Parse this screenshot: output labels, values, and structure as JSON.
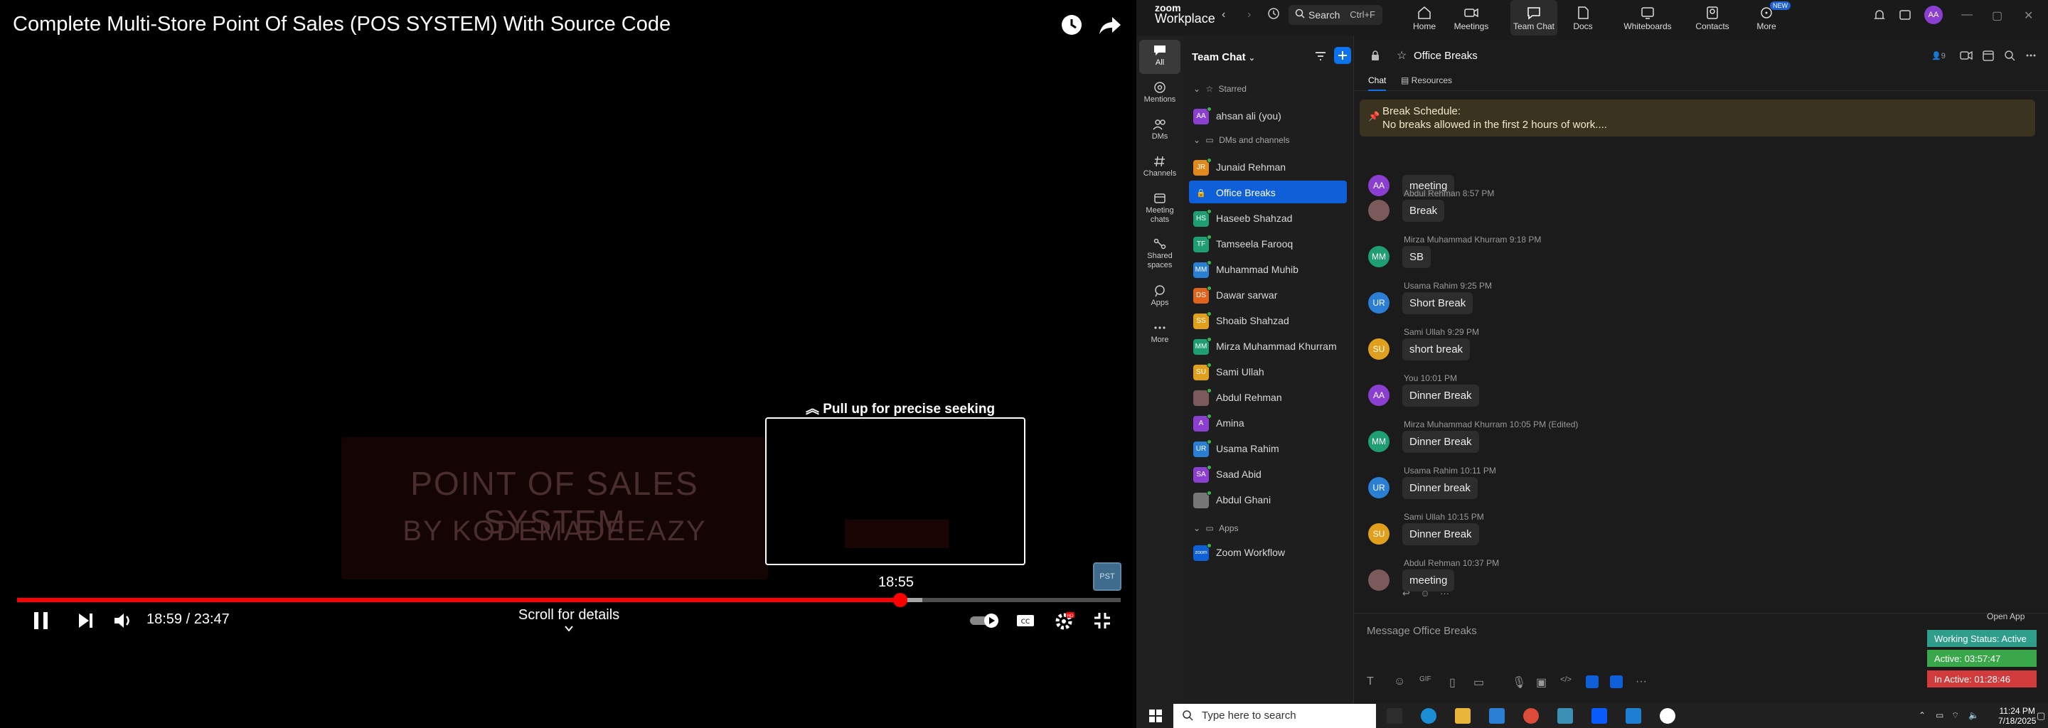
{
  "video": {
    "title": "Complete Multi-Store Point Of Sales (POS SYSTEM) With Source Code",
    "slide_line1": "POINT OF SALES SYSTEM",
    "slide_line2": "BY KODEMADEEAZY",
    "seek_hint": "Pull up for precise seeking",
    "preview_time": "18:55",
    "time_display": "18:59 / 23:47",
    "progress": 0.8,
    "buffered": 0.82,
    "scroll_hint": "Scroll for details",
    "channel_badge": "PST"
  },
  "zoom": {
    "logo_line1": "zoom",
    "logo_line2": "Workplace",
    "search_label": "Search",
    "search_shortcut": "Ctrl+F",
    "nav": [
      {
        "label": "Home"
      },
      {
        "label": "Meetings"
      },
      {
        "label": "Team Chat"
      },
      {
        "label": "Docs"
      },
      {
        "label": "Whiteboards"
      },
      {
        "label": "Contacts"
      },
      {
        "label": "More"
      }
    ],
    "new_badge": "NEW",
    "user_initials": "AA",
    "rail": [
      "All",
      "Mentions",
      "DMs",
      "Channels",
      "Meeting chats",
      "Shared spaces",
      "Apps",
      "More"
    ],
    "sidebar": {
      "title": "Team Chat",
      "starred_label": "Starred",
      "starred": [
        {
          "name": "ahsan ali (you)",
          "initials": "AA",
          "color": "#8b3fd1"
        }
      ],
      "dms_label": "DMs and channels",
      "dms": [
        {
          "name": "Junaid Rehman",
          "initials": "JR",
          "color": "#e08a1e"
        },
        {
          "name": "Office Breaks",
          "initials": "",
          "color": "#0e5fd8"
        },
        {
          "name": "Haseeb Shahzad",
          "initials": "HS",
          "color": "#1f9e74"
        },
        {
          "name": "Tamseela Farooq",
          "initials": "TF",
          "color": "#1f9e74"
        },
        {
          "name": "Muhammad Muhib",
          "initials": "MM",
          "color": "#2a7fd4"
        },
        {
          "name": "Dawar sarwar",
          "initials": "DS",
          "color": "#e0631e"
        },
        {
          "name": "Shoaib Shahzad",
          "initials": "SS",
          "color": "#e0a01e"
        },
        {
          "name": "Mirza Muhammad Khurram",
          "initials": "MM",
          "color": "#1f9e74"
        },
        {
          "name": "Sami Ullah",
          "initials": "SU",
          "color": "#e0a01e"
        },
        {
          "name": "Abdul Rehman",
          "initials": "",
          "color": "#7a5a5a"
        },
        {
          "name": "Amina",
          "initials": "A",
          "color": "#8b3fd1"
        },
        {
          "name": "Usama Rahim",
          "initials": "UR",
          "color": "#2a7fd4"
        },
        {
          "name": "Saad Abid",
          "initials": "SA",
          "color": "#8b3fd1"
        },
        {
          "name": "Abdul Ghani",
          "initials": "",
          "color": "#777"
        }
      ],
      "apps_label": "Apps",
      "apps": [
        {
          "name": "Zoom Workflow",
          "initials": "zoom",
          "color": "#0e5fd8"
        }
      ]
    },
    "chat": {
      "title": "Office Breaks",
      "tab_chat": "Chat",
      "tab_resources": "Resources",
      "member_count": "9",
      "pinned_title": "Break Schedule:",
      "pinned_text": "No breaks allowed in the first 2 hours of work....",
      "messages": [
        {
          "initials": "AA",
          "color": "#8b3fd1",
          "head": "",
          "text": "meeting"
        },
        {
          "initials": "",
          "color": "#7a5a5a",
          "head": "Abdul Rehman 8:57 PM",
          "text": "Break"
        },
        {
          "initials": "MM",
          "color": "#1f9e74",
          "head": "Mirza Muhammad Khurram 9:18 PM",
          "text": "SB"
        },
        {
          "initials": "UR",
          "color": "#2a7fd4",
          "head": "Usama Rahim 9:25 PM",
          "text": "Short Break"
        },
        {
          "initials": "SU",
          "color": "#e0a01e",
          "head": "Sami Ullah 9:29 PM",
          "text": "short break"
        },
        {
          "initials": "AA",
          "color": "#8b3fd1",
          "head": "You 10:01 PM",
          "text": "Dinner Break"
        },
        {
          "initials": "MM",
          "color": "#1f9e74",
          "head": "Mirza Muhammad Khurram 10:05 PM (Edited)",
          "text": "Dinner Break"
        },
        {
          "initials": "UR",
          "color": "#2a7fd4",
          "head": "Usama Rahim 10:11 PM",
          "text": "Dinner break"
        },
        {
          "initials": "SU",
          "color": "#e0a01e",
          "head": "Sami Ullah 10:15 PM",
          "text": "Dinner Break"
        },
        {
          "initials": "",
          "color": "#7a5a5a",
          "head": "Abdul Rehman 10:37 PM",
          "text": "meeting"
        }
      ],
      "composer_placeholder": "Message Office Breaks",
      "open_app": "Open App"
    },
    "status": {
      "working": "Working Status: Active",
      "active": "Active: 03:57:47",
      "inactive": "In Active: 01:28:46",
      "colors": {
        "working": "#2e9e8a",
        "active": "#3aa84a",
        "inactive": "#d13b3b"
      }
    }
  },
  "taskbar": {
    "search_placeholder": "Type here to search",
    "time": "11:24 PM",
    "date": "7/18/2025"
  }
}
